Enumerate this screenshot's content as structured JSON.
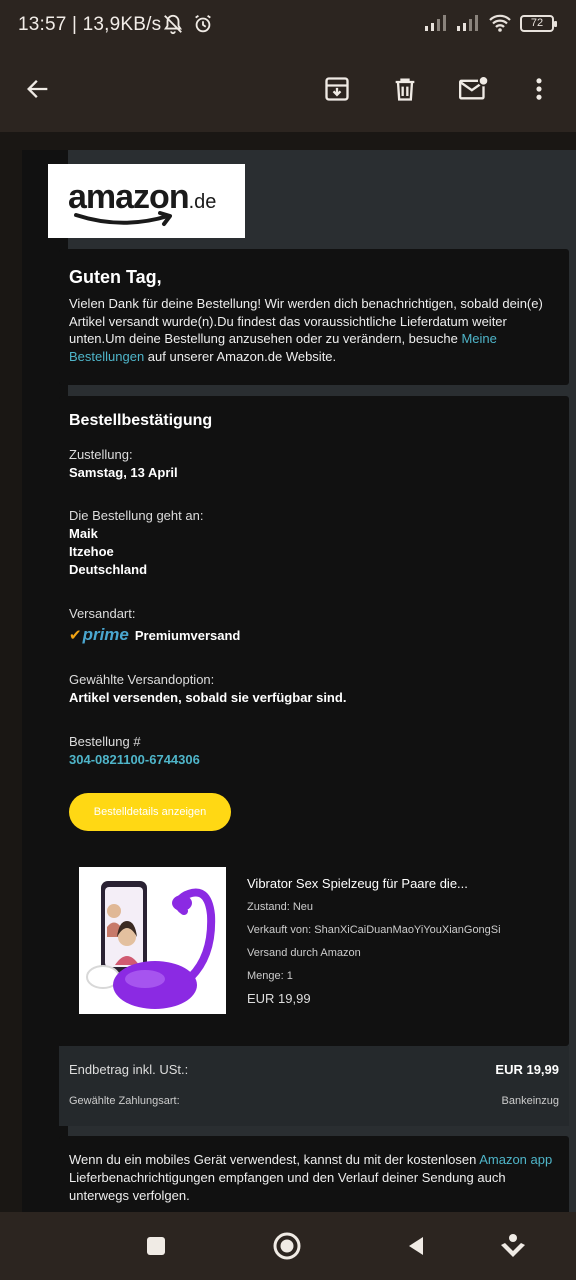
{
  "status": {
    "time_speed": "13:57 | 13,9KB/s",
    "battery": "72"
  },
  "icons": {
    "back": "arrow-left-icon",
    "archive": "archive-icon",
    "delete": "trash-icon",
    "mark_unread": "mail-unread-icon",
    "more": "more-vert-icon"
  },
  "email": {
    "logo": {
      "brand": "amazon",
      "tld": ".de"
    },
    "greeting": "Guten Tag,",
    "intro_text": "Vielen Dank für deine Bestellung! Wir werden dich benachrichtigen, sobald dein(e) Artikel versandt wurde(n).Du findest das voraussichtliche Lieferdatum weiter unten.Um deine Bestellung anzusehen oder zu verändern, besuche ",
    "intro_link": "Meine Bestellungen",
    "intro_tail": " auf unserer Amazon.de Website.",
    "confirmation_title": "Bestellbestätigung",
    "delivery_label": "Zustellung:",
    "delivery_value": "Samstag, 13 April",
    "shipto_label": "Die Bestellung geht an:",
    "shipto_name": "Maik",
    "shipto_city": "Itzehoe",
    "shipto_country": "Deutschland",
    "shipping_label": "Versandart:",
    "prime_text": "prime",
    "shipping_value": "Premiumversand",
    "option_label": "Gewählte Versandoption:",
    "option_value": "Artikel versenden, sobald sie verfügbar sind.",
    "order_label": "Bestellung #",
    "order_number": "304-0821100-6744306",
    "details_button": "Bestelldetails anzeigen",
    "product": {
      "title": "Vibrator Sex Spielzeug für Paare die...",
      "condition": "Zustand: Neu",
      "seller": "Verkauft von: ShanXiCaiDuanMaoYiYouXianGongSi",
      "fulfillment": "Versand durch Amazon",
      "quantity": "Menge: 1",
      "price": "EUR 19,99"
    },
    "total_label": "Endbetrag inkl. USt.:",
    "total_value": "EUR 19,99",
    "payment_label": "Gewählte Zahlungsart:",
    "payment_value": "Bankeinzug",
    "app_text": "Wenn du ein mobiles Gerät verwendest, kannst du mit der kostenlosen ",
    "app_link": "Amazon app",
    "app_tail": " Lieferbenachrichtigungen empfangen und den Verlauf deiner Sendung auch unterwegs verfolgen."
  },
  "colors": {
    "button_yellow": "#ffd814",
    "link_blue": "#4fb5c9",
    "prime_blue": "#4aa6cf",
    "prime_orange": "#f3a413"
  }
}
